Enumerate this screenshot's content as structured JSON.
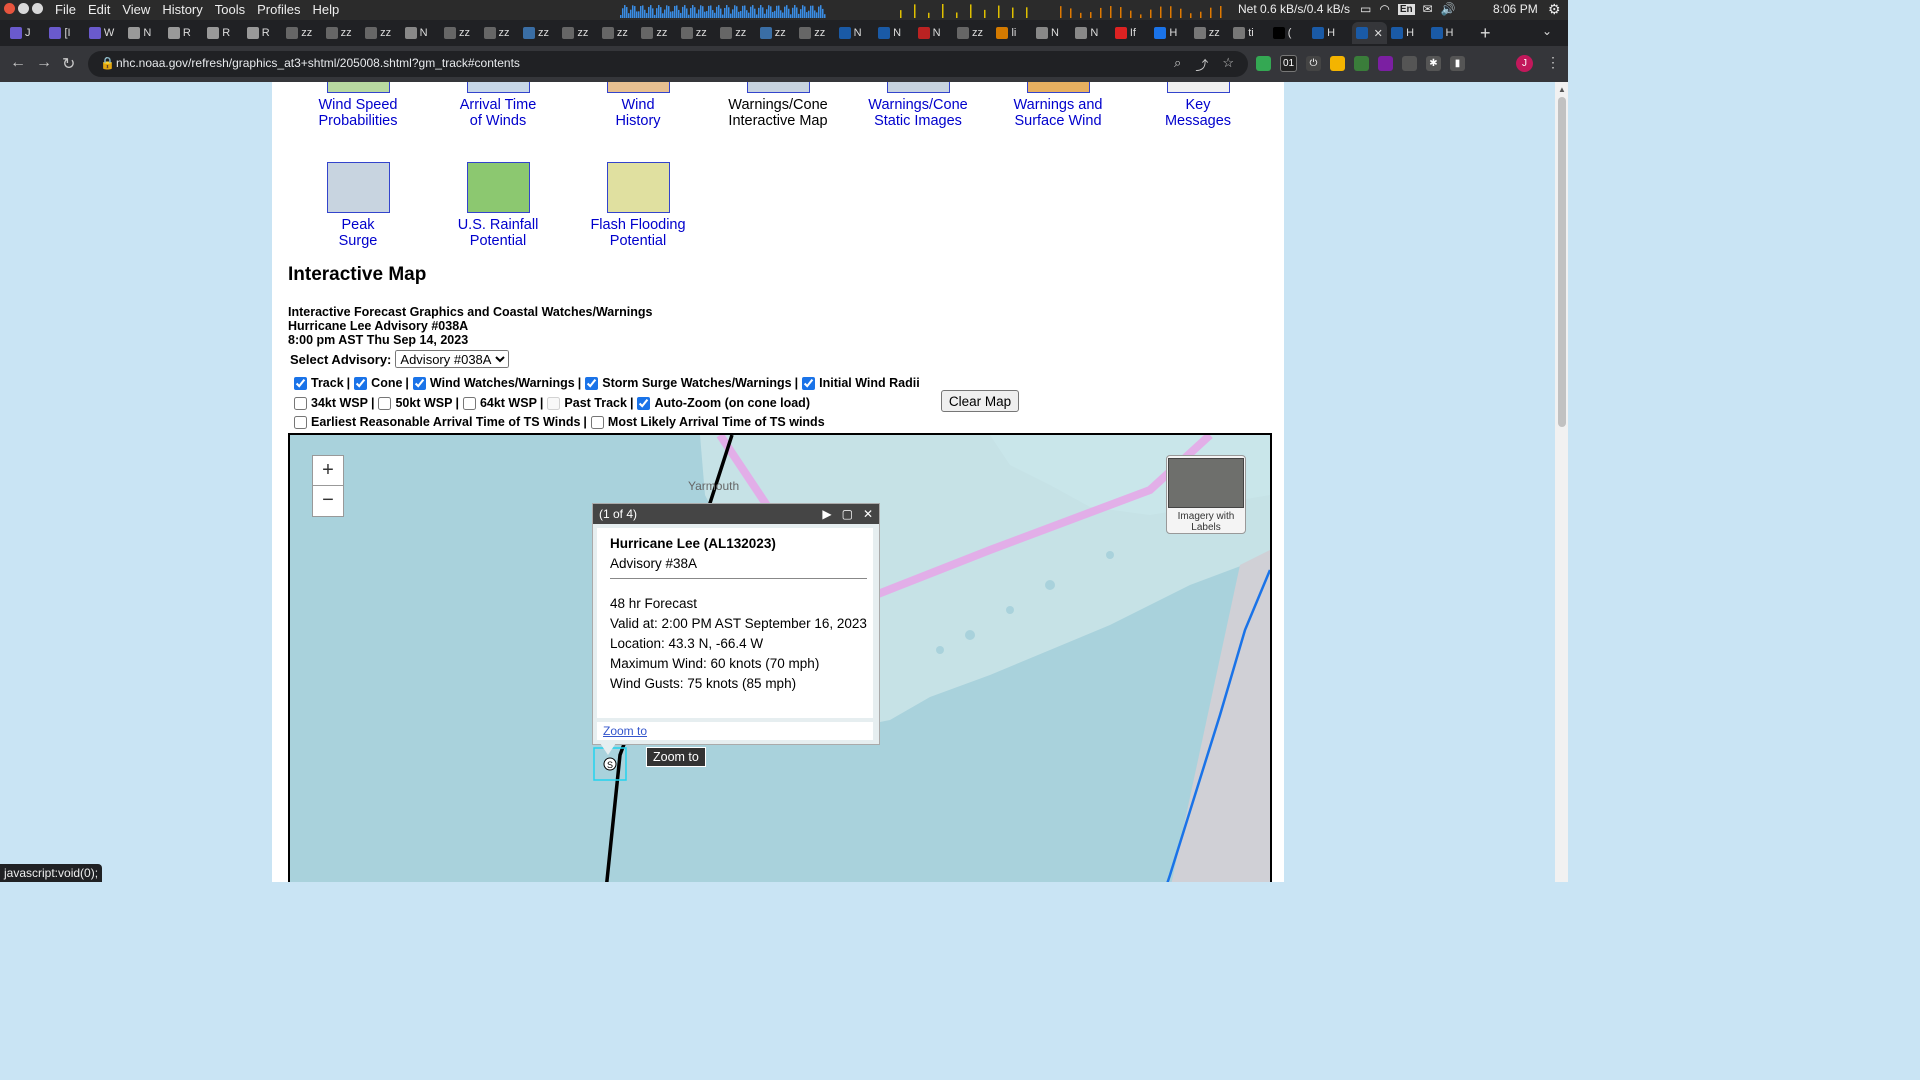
{
  "os": {
    "menus": [
      "File",
      "Edit",
      "View",
      "History",
      "Tools",
      "Profiles",
      "Help"
    ],
    "net": "Net 0.6 kB/s/0.4 kB/s",
    "lang": "En",
    "clock": "8:06 PM"
  },
  "tabs": [
    {
      "label": "J",
      "color": "#6a5acd"
    },
    {
      "label": "[I",
      "color": "#6a5acd"
    },
    {
      "label": "W",
      "color": "#6a5acd"
    },
    {
      "label": "N",
      "color": "#999"
    },
    {
      "label": "R",
      "color": "#999"
    },
    {
      "label": "R",
      "color": "#999"
    },
    {
      "label": "R",
      "color": "#999"
    },
    {
      "label": "zz",
      "color": "#666"
    },
    {
      "label": "zz",
      "color": "#666"
    },
    {
      "label": "zz",
      "color": "#666"
    },
    {
      "label": "N",
      "color": "#888"
    },
    {
      "label": "zz",
      "color": "#666"
    },
    {
      "label": "zz",
      "color": "#666"
    },
    {
      "label": "zz",
      "color": "#3a6ea5"
    },
    {
      "label": "zz",
      "color": "#666"
    },
    {
      "label": "zz",
      "color": "#666"
    },
    {
      "label": "zz",
      "color": "#666"
    },
    {
      "label": "zz",
      "color": "#666"
    },
    {
      "label": "zz",
      "color": "#666"
    },
    {
      "label": "zz",
      "color": "#3a6ea5"
    },
    {
      "label": "zz",
      "color": "#666"
    },
    {
      "label": "N",
      "color": "#1a5aa6"
    },
    {
      "label": "N",
      "color": "#1a5aa6"
    },
    {
      "label": "N",
      "color": "#b22"
    },
    {
      "label": "zz",
      "color": "#666"
    },
    {
      "label": "li",
      "color": "#d47a00"
    },
    {
      "label": "N",
      "color": "#888"
    },
    {
      "label": "N",
      "color": "#888"
    },
    {
      "label": "If",
      "color": "#d22"
    },
    {
      "label": "H",
      "color": "#1a73e8"
    },
    {
      "label": "zz",
      "color": "#777"
    },
    {
      "label": "ti",
      "color": "#777"
    },
    {
      "label": "(",
      "color": "#000"
    },
    {
      "label": "H",
      "color": "#1a5aa6"
    },
    {
      "label": "",
      "color": "#1a5aa6"
    },
    {
      "label": "H",
      "color": "#1a5aa6"
    },
    {
      "label": "H",
      "color": "#1a5aa6"
    }
  ],
  "address": {
    "url": "nhc.noaa.gov/refresh/graphics_at3+shtml/205008.shtml?gm_track#contents"
  },
  "products_row1": [
    {
      "line1": "Wind Speed",
      "line2": "Probabilities",
      "link": true
    },
    {
      "line1": "Arrival Time",
      "line2": "of Winds",
      "link": true
    },
    {
      "line1": "Wind",
      "line2": "History",
      "link": true
    },
    {
      "line1": "Warnings/Cone",
      "line2": "Interactive Map",
      "link": false
    },
    {
      "line1": "Warnings/Cone",
      "line2": "Static Images",
      "link": true
    },
    {
      "line1": "Warnings and",
      "line2": "Surface Wind",
      "link": true
    },
    {
      "line1": "Key",
      "line2": "Messages",
      "link": true
    }
  ],
  "products_row2": [
    {
      "line1": "Peak",
      "line2": "Surge"
    },
    {
      "line1": "U.S. Rainfall",
      "line2": "Potential"
    },
    {
      "line1": "Flash Flooding",
      "line2": "Potential"
    }
  ],
  "interactive": {
    "heading": "Interactive Map",
    "info1": "Interactive Forecast Graphics and Coastal Watches/Warnings",
    "info2": "Hurricane Lee Advisory #038A",
    "info3": "8:00 pm AST Thu Sep 14, 2023",
    "select_label": "Select Advisory:",
    "select_value": "Advisory #038A",
    "clear_label": "Clear Map"
  },
  "checks": {
    "row1": [
      {
        "label": "Track",
        "checked": true
      },
      {
        "label": "Cone",
        "checked": true
      },
      {
        "label": "Wind Watches/Warnings",
        "checked": true
      },
      {
        "label": "Storm Surge Watches/Warnings",
        "checked": true
      },
      {
        "label": "Initial Wind Radii",
        "checked": true
      }
    ],
    "row2": [
      {
        "label": "34kt WSP",
        "checked": false
      },
      {
        "label": "50kt WSP",
        "checked": false
      },
      {
        "label": "64kt WSP",
        "checked": false
      },
      {
        "label": "Past Track",
        "checked": false,
        "disabled": true
      },
      {
        "label": "Auto-Zoom (on cone load)",
        "checked": true
      }
    ],
    "row3": [
      {
        "label": "Earliest Reasonable Arrival Time of TS Winds",
        "checked": false
      },
      {
        "label": "Most Likely Arrival Time of TS winds",
        "checked": false
      }
    ]
  },
  "map": {
    "zoom_in": "+",
    "zoom_out": "−",
    "place_label": "Yarmouth",
    "layer_toggle_label": "Imagery with Labels",
    "track_marker": "S"
  },
  "popup": {
    "counter": "(1 of 4)",
    "title": "Hurricane Lee (AL132023)",
    "advisory": "Advisory #38A",
    "forecast": "48 hr Forecast",
    "valid": "Valid at: 2:00 PM AST September 16, 2023",
    "location": "Location: 43.3 N, -66.4 W",
    "max_wind": "Maximum Wind: 60 knots (70 mph)",
    "gusts": "Wind Gusts: 75 knots (85 mph)",
    "zoom_link": "Zoom to"
  },
  "tooltip": "Zoom to",
  "status_bar": "javascript:void(0);"
}
